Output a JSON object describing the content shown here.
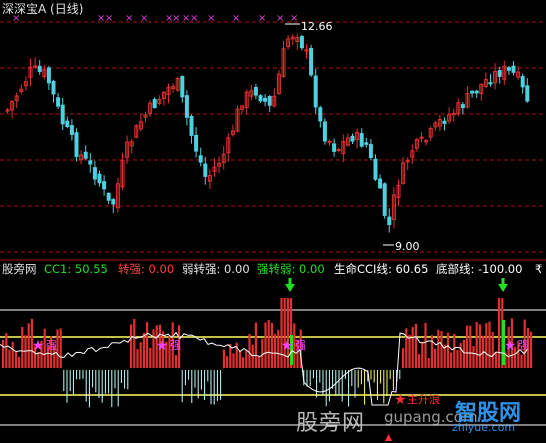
{
  "window_title": "深深宝A (日线)",
  "price_labels": {
    "high": "12.66",
    "low": "9.00"
  },
  "indicator_bar": {
    "name": "股旁网",
    "cc1": "CC1: 50.55",
    "zhuanqiang": "转强: 0.00",
    "ruozhuanqiang": "弱转强: 0.00",
    "qiangzhuanruo": "强转弱: 0.00",
    "shengming": "生命CCI线: 60.65",
    "dibuxian": "底部线: -100.00",
    "more": "₹"
  },
  "signals": {
    "qiang": "强",
    "zhusheng": "主升浪"
  },
  "watermarks": {
    "site1": "股旁网",
    "site_url": "gupang.com",
    "site2": "智股网",
    "site2_url": "zhiyue.com"
  },
  "colors": {
    "up": "#e03030",
    "down": "#4fd0e0",
    "grid": "#b01010",
    "white_line": "#ffffff",
    "yellow": "#ffff60",
    "green": "#20e020",
    "magenta": "#e040e0"
  }
}
